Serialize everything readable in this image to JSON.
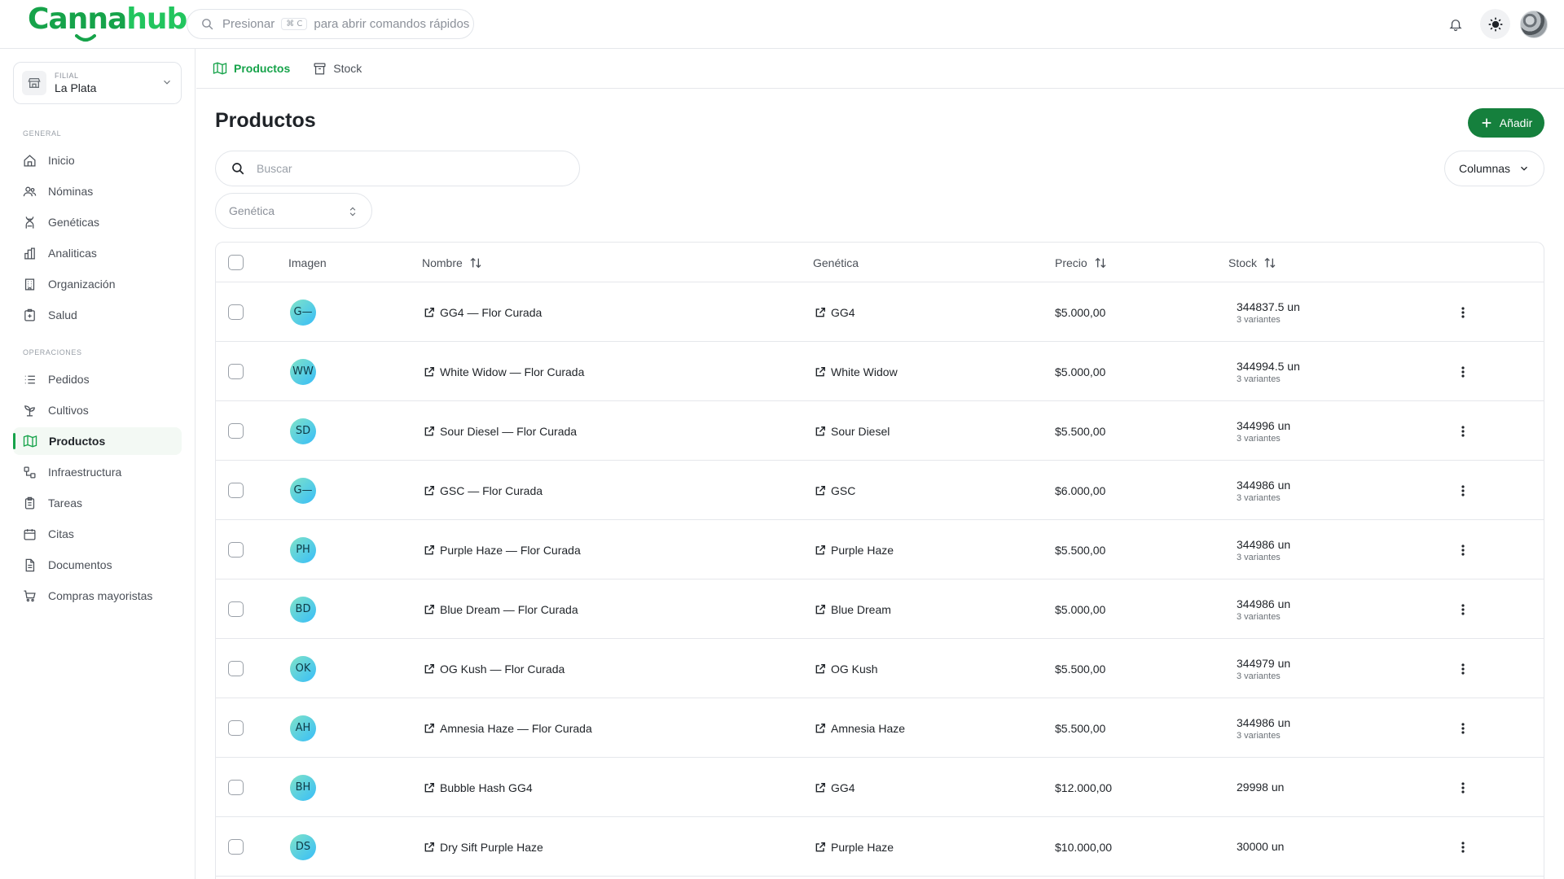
{
  "app": {
    "logo_part1": "Canna",
    "logo_part2": "hub"
  },
  "command_bar": {
    "prefix": "Presionar",
    "shortcut": "⌘ C",
    "suffix": "para abrir comandos rápidos"
  },
  "top_icons": [
    "bell-icon",
    "sun-icon",
    "user-avatar"
  ],
  "branch": {
    "label": "FILIAL",
    "name": "La Plata"
  },
  "sidebar": {
    "general_title": "GENERAL",
    "general": [
      {
        "label": "Inicio",
        "icon": "home-icon"
      },
      {
        "label": "Nóminas",
        "icon": "users-icon"
      },
      {
        "label": "Genéticas",
        "icon": "dna-icon"
      },
      {
        "label": "Analiticas",
        "icon": "chart-icon"
      },
      {
        "label": "Organización",
        "icon": "building-icon"
      },
      {
        "label": "Salud",
        "icon": "health-icon"
      }
    ],
    "operaciones_title": "OPERACIONES",
    "operaciones": [
      {
        "label": "Pedidos",
        "icon": "list-icon"
      },
      {
        "label": "Cultivos",
        "icon": "plant-icon"
      },
      {
        "label": "Productos",
        "icon": "map-icon",
        "active": true
      },
      {
        "label": "Infraestructura",
        "icon": "infra-icon"
      },
      {
        "label": "Tareas",
        "icon": "clipboard-icon"
      },
      {
        "label": "Citas",
        "icon": "calendar-icon"
      },
      {
        "label": "Documentos",
        "icon": "document-icon"
      },
      {
        "label": "Compras mayoristas",
        "icon": "cart-icon"
      }
    ]
  },
  "tabs": [
    {
      "label": "Productos",
      "active": true,
      "icon": "map-icon"
    },
    {
      "label": "Stock",
      "active": false,
      "icon": "archive-icon"
    }
  ],
  "main": {
    "title": "Productos",
    "add_label": "Añadir",
    "search_placeholder": "Buscar",
    "columns_label": "Columnas",
    "filter_placeholder": "Genética"
  },
  "table": {
    "headers": {
      "image": "Imagen",
      "name": "Nombre",
      "genetics": "Genética",
      "price": "Precio",
      "stock": "Stock"
    },
    "rows": [
      {
        "initials": "G—",
        "name": "GG4 — Flor Curada",
        "genetics": "GG4",
        "price": "$5.000,00",
        "stock": "344837.5 un",
        "variants": "3 variantes"
      },
      {
        "initials": "WW",
        "name": "White Widow — Flor Curada",
        "genetics": "White Widow",
        "price": "$5.000,00",
        "stock": "344994.5 un",
        "variants": "3 variantes"
      },
      {
        "initials": "SD",
        "name": "Sour Diesel — Flor Curada",
        "genetics": "Sour Diesel",
        "price": "$5.500,00",
        "stock": "344996 un",
        "variants": "3 variantes"
      },
      {
        "initials": "G—",
        "name": "GSC — Flor Curada",
        "genetics": "GSC",
        "price": "$6.000,00",
        "stock": "344986 un",
        "variants": "3 variantes"
      },
      {
        "initials": "PH",
        "name": "Purple Haze — Flor Curada",
        "genetics": "Purple Haze",
        "price": "$5.500,00",
        "stock": "344986 un",
        "variants": "3 variantes"
      },
      {
        "initials": "BD",
        "name": "Blue Dream — Flor Curada",
        "genetics": "Blue Dream",
        "price": "$5.000,00",
        "stock": "344986 un",
        "variants": "3 variantes"
      },
      {
        "initials": "OK",
        "name": "OG Kush — Flor Curada",
        "genetics": "OG Kush",
        "price": "$5.500,00",
        "stock": "344979 un",
        "variants": "3 variantes"
      },
      {
        "initials": "AH",
        "name": "Amnesia Haze — Flor Curada",
        "genetics": "Amnesia Haze",
        "price": "$5.500,00",
        "stock": "344986 un",
        "variants": "3 variantes"
      },
      {
        "initials": "BH",
        "name": "Bubble Hash GG4",
        "genetics": "GG4",
        "price": "$12.000,00",
        "stock": "29998 un",
        "variants": ""
      },
      {
        "initials": "DS",
        "name": "Dry Sift Purple Haze",
        "genetics": "Purple Haze",
        "price": "$10.000,00",
        "stock": "30000 un",
        "variants": ""
      }
    ]
  },
  "colors": {
    "brand": "#16a34a",
    "brand_dark": "#15803d",
    "border": "#e5e7eb"
  }
}
